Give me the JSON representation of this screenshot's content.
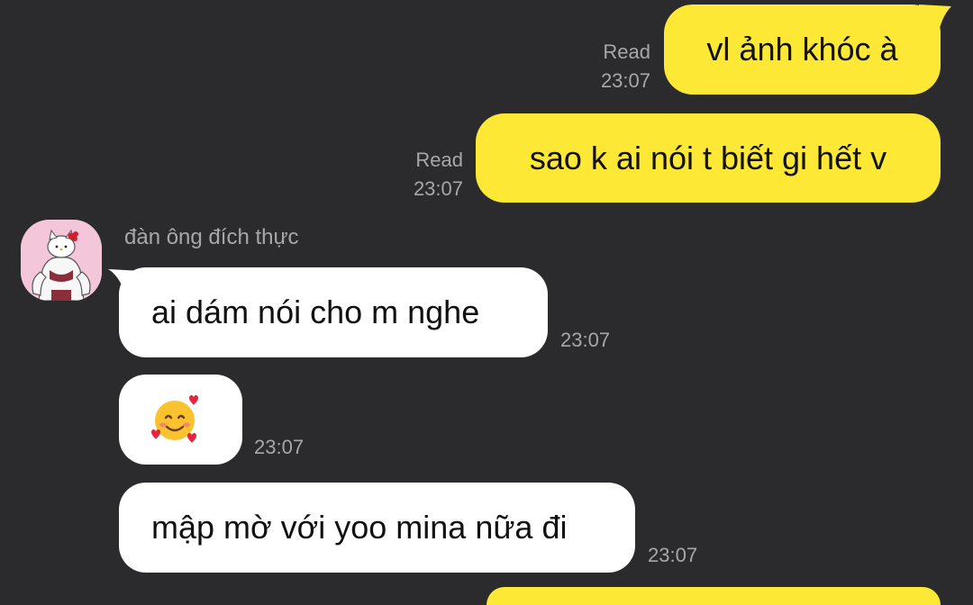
{
  "colors": {
    "background": "#2b2b2d",
    "outgoing_bubble": "#fde835",
    "incoming_bubble": "#ffffff",
    "meta_text": "#a7a7aa"
  },
  "outgoing": [
    {
      "text": "vl ảnh khóc à",
      "status": "Read",
      "time": "23:07"
    },
    {
      "text": "sao k ai nói t biết gi hết v",
      "status": "Read",
      "time": "23:07"
    }
  ],
  "contact": {
    "name": "đàn ông đích thực",
    "avatar_icon": "hello-kitty-muscle-avatar"
  },
  "incoming": [
    {
      "text": "ai dám nói cho m nghe",
      "time": "23:07"
    },
    {
      "text": "",
      "emoji": "smiling-face-with-hearts",
      "time": "23:07"
    },
    {
      "text": "mập mờ với yoo mina nữa đi",
      "time": "23:07"
    }
  ]
}
